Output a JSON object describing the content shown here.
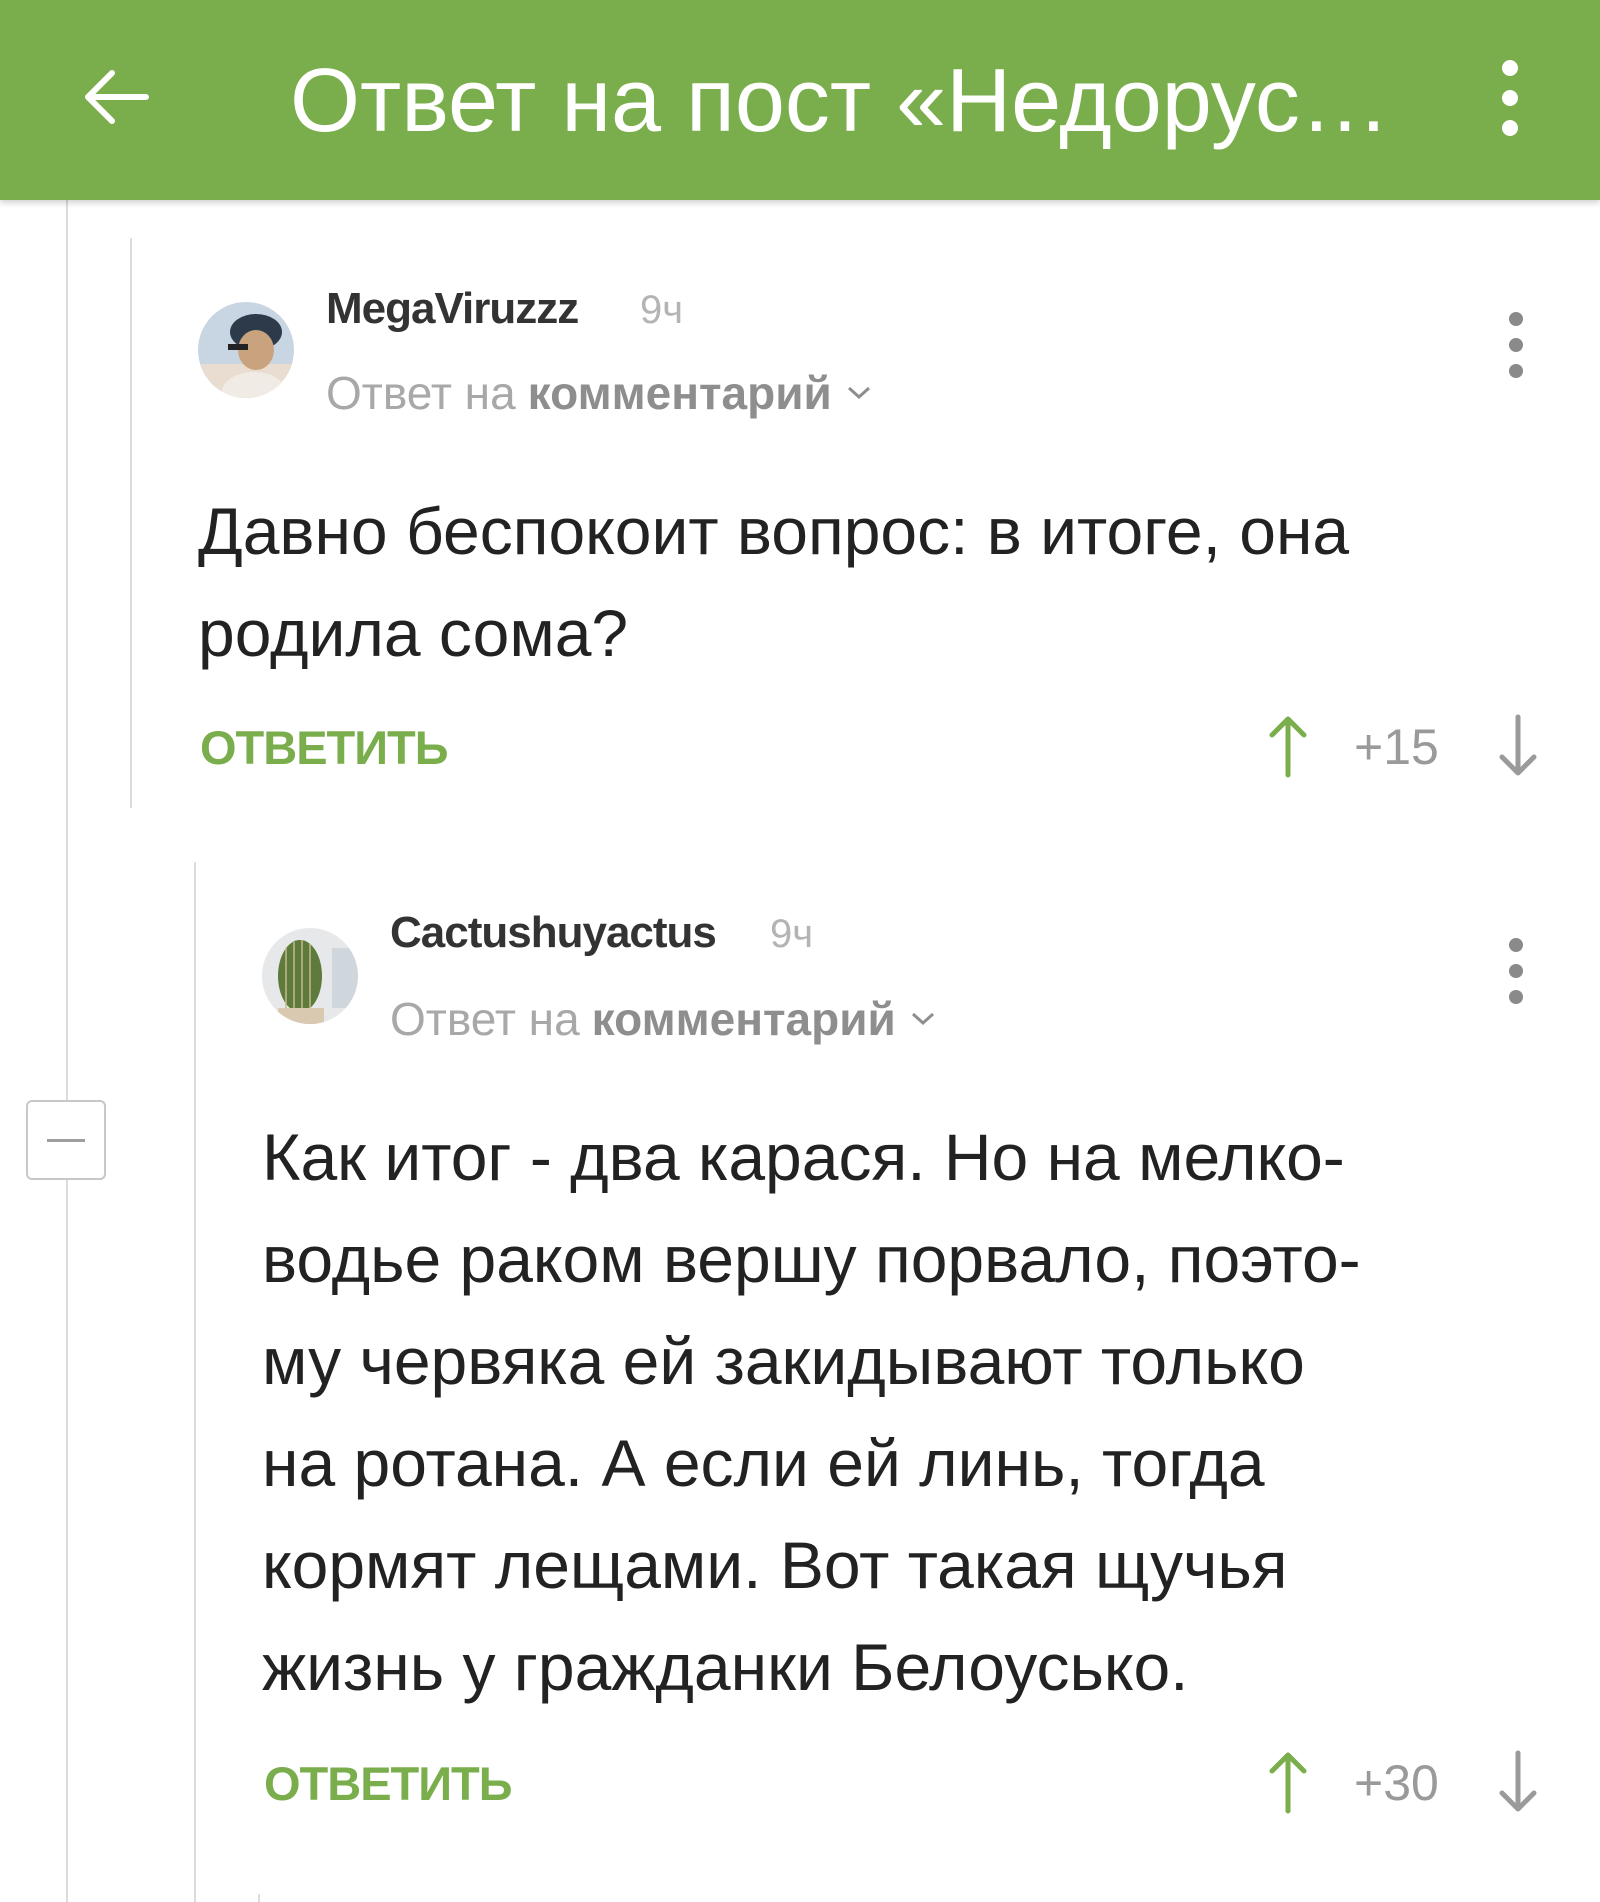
{
  "topbar": {
    "title": "Ответ на пост «Недорус…",
    "back_icon": "arrow-left-icon",
    "menu_icon": "more-vert-icon"
  },
  "colors": {
    "brand": "#7aad4b",
    "text": "#222222",
    "muted": "#a8a8a8",
    "line": "#dcdcdc"
  },
  "comments": [
    {
      "username": "MegaViruzzz",
      "time": "9ч",
      "reply_prefix": "Ответ на",
      "reply_link": "комментарий",
      "lines": [
        "Давно беспокоит вопрос: в итоге, она",
        "родила сома?"
      ],
      "reply_label": "ОТВЕТИТЬ",
      "rating": "+15"
    },
    {
      "username": "Cactushuyactus",
      "time": "9ч",
      "reply_prefix": "Ответ на",
      "reply_link": "комментарий",
      "lines": [
        "Как итог - два карася. Но на мелко-",
        "водье раком вершу порвало, поэто-",
        "му червяка ей закидывают только",
        "на ротана. А если ей линь, тогда",
        "кормят лещами. Вот такая щучья",
        "жизнь у гражданки Белоусько."
      ],
      "reply_label": "ОТВЕТИТЬ",
      "rating": "+30"
    }
  ]
}
